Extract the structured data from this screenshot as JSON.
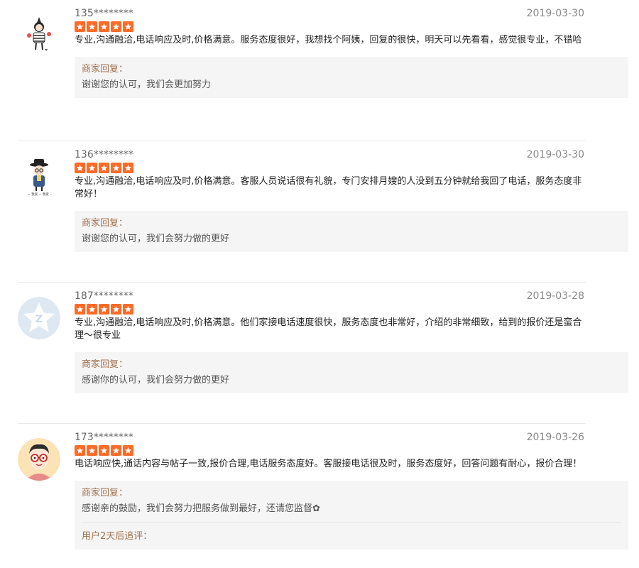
{
  "reviews": [
    {
      "user": "135********",
      "date": "2019-03-30",
      "rating": 5,
      "text": "专业,沟通融洽,电话响应及时,价格满意。服务态度很好，我想找个阿姨，回复的很快，明天可以先看看，感觉很专业，不错哈",
      "reply_label": "商家回复：",
      "reply_text": "谢谢您的认可，我们会更加努力",
      "avatar_icon": "girl-figure-avatar"
    },
    {
      "user": "136********",
      "date": "2019-03-30",
      "rating": 5,
      "text": "专业,沟通融洽,电话响应及时,价格满意。客服人员说话很有礼貌，专门安排月嫂的人没到五分钟就给我回了电话，服务态度非常好！",
      "reply_label": "商家回复：",
      "reply_text": "谢谢您的认可，我们会努力做的更好",
      "avatar_icon": "hat-figure-avatar"
    },
    {
      "user": "187********",
      "date": "2019-03-28",
      "rating": 5,
      "text": "专业,沟通融洽,电话响应及时,价格满意。他们家接电话速度很快，服务态度也非常好，介绍的非常细致，给到的报价还是蛮合理～很专业",
      "reply_label": "商家回复：",
      "reply_text": "感谢你的认可，我们会努力做的更好",
      "avatar_icon": "default-star-avatar"
    },
    {
      "user": "173********",
      "date": "2019-03-26",
      "rating": 5,
      "text": "电话响应快,通话内容与帖子一致,报价合理,电话服务态度好。客服接电话很及时，服务态度好，回答问题有耐心，报价合理！",
      "reply_label": "商家回复：",
      "reply_text": "感谢亲的鼓励，我们会努力把服务做到最好，还请您监督✿",
      "followup_label": "用户2天后追评：",
      "avatar_icon": "glasses-boy-avatar"
    }
  ],
  "colors": {
    "star": "#ff6a26",
    "reply_label": "#a3714f",
    "reply_bg": "#f5f5f5"
  }
}
